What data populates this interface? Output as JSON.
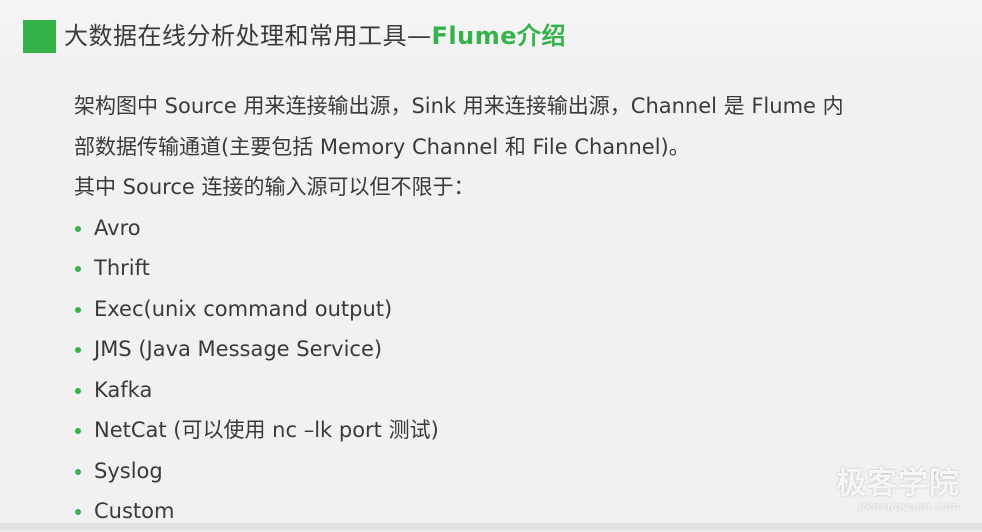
{
  "slide": {
    "title_main": "大数据在线分析处理和常用工具—",
    "title_highlight": "Flume介绍",
    "paragraph_line1": "架构图中 Source  用来连接输出源，Sink 用来连接输出源，Channel 是 Flume 内",
    "paragraph_line2": "部数据传输通道(主要包括 Memory Channel 和 File Channel)。",
    "paragraph_line3": "其中 Source 连接的输入源可以但不限于：",
    "bullets": [
      "Avro",
      "Thrift",
      "Exec(unix command  output)",
      "JMS (Java Message Service)",
      "Kafka",
      "NetCat (可以使用 nc –lk port 测试)",
      "Syslog",
      "Custom"
    ]
  },
  "watermark": {
    "main": "极客学院",
    "sub": "jikexueyuan.com"
  },
  "colors": {
    "accent": "#35b34a",
    "text": "#3a3a3a",
    "background": "#f1f1f1"
  }
}
